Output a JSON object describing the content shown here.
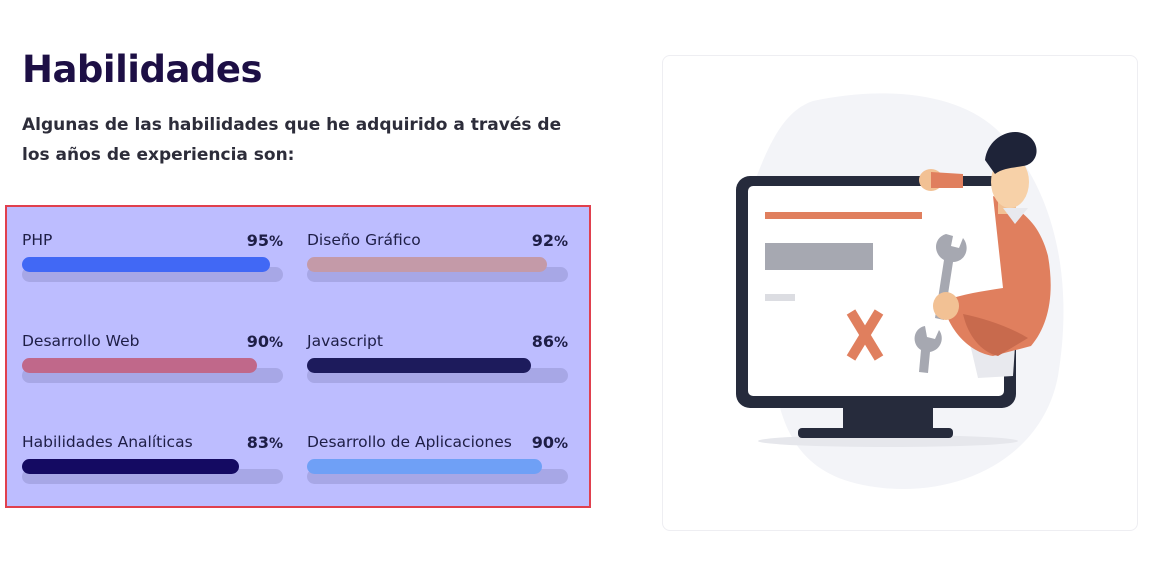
{
  "header": {
    "title": "Habilidades",
    "subtitle": "Algunas de las habilidades que he adquirido a través de los años de experiencia son:"
  },
  "skills": [
    {
      "name": "PHP",
      "percent": "95",
      "percent_symbol": "%",
      "level": 0.95,
      "color": "#4168f5"
    },
    {
      "name": "Diseño Gráfico",
      "percent": "92",
      "percent_symbol": "%",
      "level": 0.92,
      "color": "#c49aa8"
    },
    {
      "name": "Desarrollo Web",
      "percent": "90",
      "percent_symbol": "%",
      "level": 0.9,
      "color": "#c0688a"
    },
    {
      "name": "Javascript",
      "percent": "86",
      "percent_symbol": "%",
      "level": 0.86,
      "color": "#1d1b5c"
    },
    {
      "name": "Habilidades Analíticas",
      "percent": "83",
      "percent_symbol": "%",
      "level": 0.83,
      "color": "#140a62"
    },
    {
      "name": "Desarrollo de Aplicaciones",
      "percent": "90",
      "percent_symbol": "%",
      "level": 0.9,
      "color": "#6fa0f6"
    }
  ],
  "illustration": {
    "name": "developer-repairing-monitor-illustration",
    "colors": {
      "monitor": "#262b3c",
      "accent": "#e07f5e",
      "gray": "#a6a8b1",
      "blob": "#f3f4f8"
    }
  }
}
